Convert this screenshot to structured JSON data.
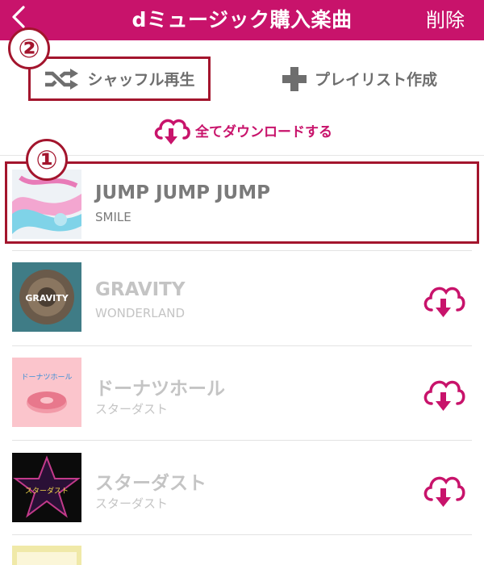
{
  "header": {
    "title": "dミュージック購入楽曲",
    "delete_label": "削除",
    "background": "#c8136b"
  },
  "actions": {
    "shuffle_label": "シャッフル再生",
    "playlist_label": "プレイリスト作成",
    "download_all_label": "全てダウンロードする"
  },
  "badges": {
    "shuffle_number": "②",
    "track_number": "①"
  },
  "tracks": [
    {
      "title": "JUMP JUMP JUMP",
      "artist": "SMILE",
      "art_icon": "abstract-pink-blue-art",
      "downloaded": true
    },
    {
      "title": "GRAVITY",
      "artist": "WONDERLAND",
      "art_icon": "planet-gravity-art",
      "art_text": "GRAVITY",
      "downloaded": false
    },
    {
      "title": "ドーナツホール",
      "artist": "スターダスト",
      "art_icon": "donut-art",
      "art_text": "ドーナツホール",
      "downloaded": false
    },
    {
      "title": "スターダスト",
      "artist": "スターダスト",
      "art_icon": "star-art",
      "art_text": "スターダスト",
      "downloaded": false
    }
  ],
  "colors": {
    "accent": "#c8136b",
    "annotation": "#a3152d",
    "text_primary": "#7a7a7a",
    "text_dim": "#c4c4c4"
  }
}
